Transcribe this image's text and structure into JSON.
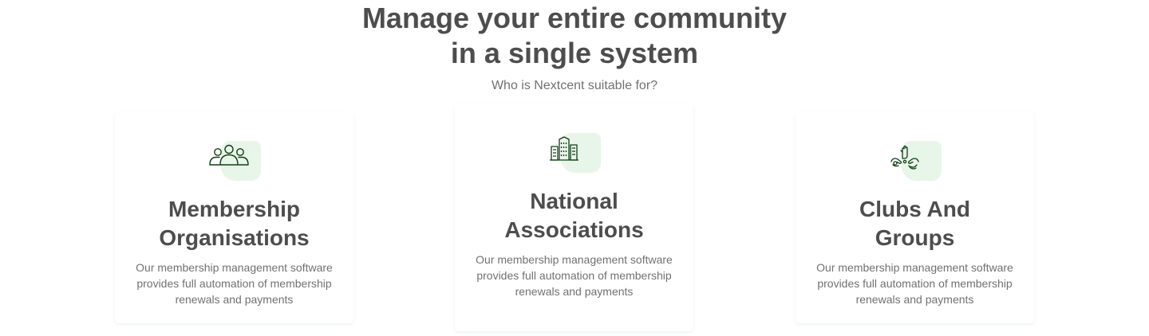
{
  "header": {
    "title_line1": "Manage your entire community",
    "title_line2": "in a single system",
    "subtitle": "Who is Nextcent suitable for?"
  },
  "cards": [
    {
      "icon": "members-group-icon",
      "title_line1": "Membership",
      "title_line2": "Organisations",
      "text": "Our membership management software provides full automation of membership renewals and payments"
    },
    {
      "icon": "building-icon",
      "title_line1": "National",
      "title_line2": "Associations",
      "text": "Our membership management software provides full automation of membership renewals and payments"
    },
    {
      "icon": "hands-group-icon",
      "title_line1": "Clubs And",
      "title_line2": "Groups",
      "text": "Our membership management software provides full automation of membership renewals and payments"
    }
  ],
  "colors": {
    "heading": "#4d4d4d",
    "body_text": "#717171",
    "icon_stroke": "#103e13",
    "icon_bg": "#e8f5e9"
  }
}
